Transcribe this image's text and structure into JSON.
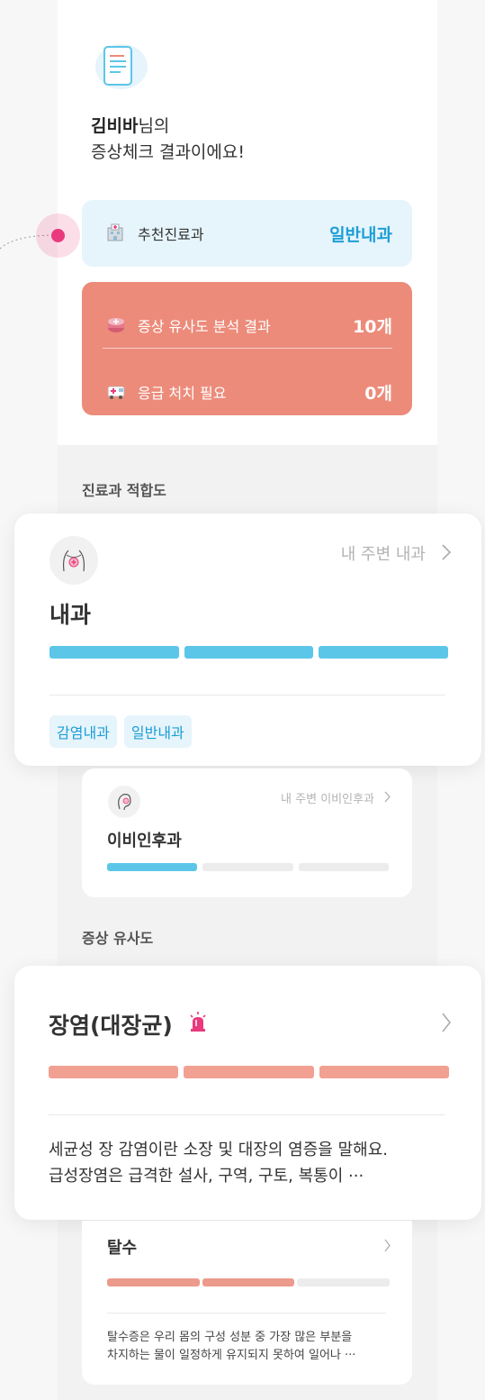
{
  "greeting": {
    "name": "김비바",
    "name_suffix": "님의",
    "line2": "증상체크 결과이에요!"
  },
  "recommended_dept": {
    "label": "추천진료과",
    "value": "일반내과"
  },
  "analysis": {
    "similarity_label": "증상 유사도 분석 결과",
    "similarity_value": "10개",
    "emergency_label": "응급 처치 필요",
    "emergency_value": "0개"
  },
  "sections": {
    "dept_fit": "진료과 적합도",
    "symptom_similarity": "증상 유사도"
  },
  "dept_cards": [
    {
      "name": "내과",
      "nearby_link": "내 주변 내과",
      "level_filled": 3,
      "level_total": 3,
      "tags": [
        "감염내과",
        "일반내과"
      ],
      "icon": "chest-icon"
    },
    {
      "name": "이비인후과",
      "nearby_link": "내 주변 이비인후과",
      "level_filled": 1,
      "level_total": 3,
      "icon": "ear-icon"
    }
  ],
  "symptom_cards": [
    {
      "name": "장염(대장균)",
      "alarm_icon": "siren-icon",
      "level_filled": 3,
      "level_total": 3,
      "desc_line1": "세균성 장 감염이란 소장 및 대장의 염증을 말해요.",
      "desc_line2": "급성장염은 급격한 설사, 구역, 구토, 복통이  ···"
    },
    {
      "name": "탈수",
      "level_filled": 2,
      "level_total": 3,
      "desc_line1": "탈수증은 우리 몸의 구성 성분 중 가장 많은 부분을",
      "desc_line2": "차지하는 물이 일정하게 유지되지 못하여 일어나 ···"
    }
  ],
  "colors": {
    "accent_blue": "#1c9ed6",
    "bar_blue": "#5cc6e8",
    "alert_red": "#ec8b7a",
    "pointer_pink": "#e93a7d"
  }
}
